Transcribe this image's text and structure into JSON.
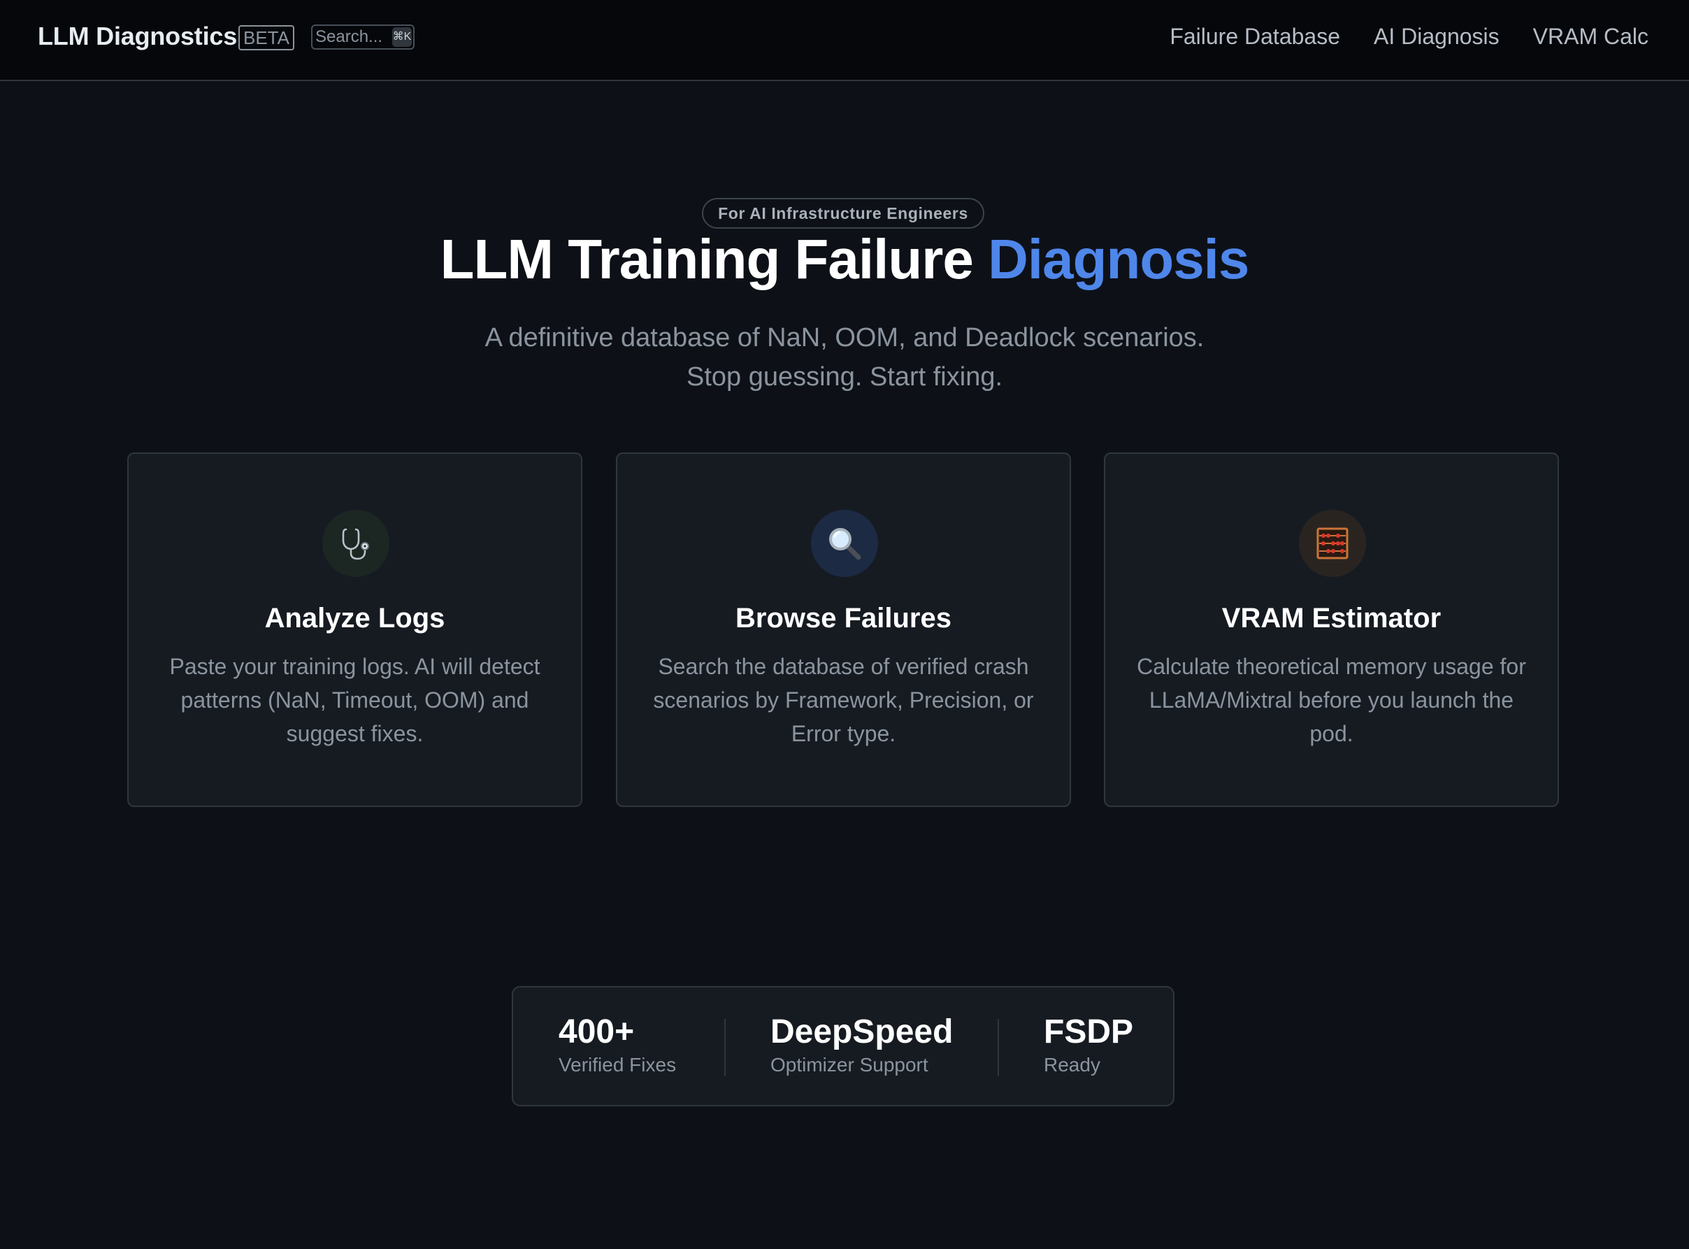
{
  "navbar": {
    "brand": "LLM Diagnostics",
    "badge": "BETA",
    "search_placeholder": "Search...",
    "search_shortcut": "⌘K",
    "links": [
      {
        "label": "Failure Database"
      },
      {
        "label": "AI Diagnosis"
      },
      {
        "label": "VRAM Calc"
      }
    ]
  },
  "hero": {
    "pill": "For AI Infrastructure Engineers",
    "title_main": "LLM Training Failure ",
    "title_accent": "Diagnosis",
    "subtitle_line1": "A definitive database of NaN, OOM, and Deadlock scenarios.",
    "subtitle_line2": "Stop guessing. Start fixing."
  },
  "cards": [
    {
      "icon": "stethoscope-icon",
      "title": "Analyze Logs",
      "description": "Paste your training logs. AI will detect patterns (NaN, Timeout, OOM) and suggest fixes."
    },
    {
      "icon": "magnifying-glass-icon",
      "title": "Browse Failures",
      "description": "Search the database of verified crash scenarios by Framework, Precision, or Error type."
    },
    {
      "icon": "abacus-icon",
      "title": "VRAM Estimator",
      "description": "Calculate theoretical memory usage for LLaMA/Mixtral before you launch the pod."
    }
  ],
  "stats": [
    {
      "value": "400+",
      "label": "Verified Fixes"
    },
    {
      "value": "DeepSpeed",
      "label": "Optimizer Support"
    },
    {
      "value": "FSDP",
      "label": "Ready"
    }
  ],
  "colors": {
    "background": "#0d1117",
    "navbar": "#05070b",
    "card": "#161b22",
    "border": "#30363d",
    "accent": "#4f86ea",
    "muted_text": "#8b949e"
  }
}
